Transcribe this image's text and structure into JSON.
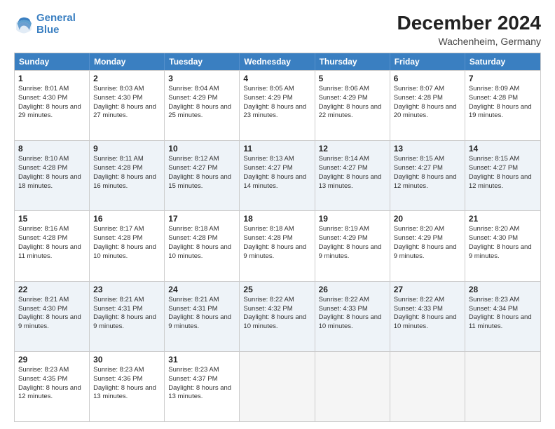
{
  "logo": {
    "line1": "General",
    "line2": "Blue"
  },
  "title": "December 2024",
  "location": "Wachenheim, Germany",
  "days_header": [
    "Sunday",
    "Monday",
    "Tuesday",
    "Wednesday",
    "Thursday",
    "Friday",
    "Saturday"
  ],
  "weeks": [
    [
      {
        "day": "1",
        "rise": "Sunrise: 8:01 AM",
        "set": "Sunset: 4:30 PM",
        "day_text": "Daylight: 8 hours and 29 minutes."
      },
      {
        "day": "2",
        "rise": "Sunrise: 8:03 AM",
        "set": "Sunset: 4:30 PM",
        "day_text": "Daylight: 8 hours and 27 minutes."
      },
      {
        "day": "3",
        "rise": "Sunrise: 8:04 AM",
        "set": "Sunset: 4:29 PM",
        "day_text": "Daylight: 8 hours and 25 minutes."
      },
      {
        "day": "4",
        "rise": "Sunrise: 8:05 AM",
        "set": "Sunset: 4:29 PM",
        "day_text": "Daylight: 8 hours and 23 minutes."
      },
      {
        "day": "5",
        "rise": "Sunrise: 8:06 AM",
        "set": "Sunset: 4:29 PM",
        "day_text": "Daylight: 8 hours and 22 minutes."
      },
      {
        "day": "6",
        "rise": "Sunrise: 8:07 AM",
        "set": "Sunset: 4:28 PM",
        "day_text": "Daylight: 8 hours and 20 minutes."
      },
      {
        "day": "7",
        "rise": "Sunrise: 8:09 AM",
        "set": "Sunset: 4:28 PM",
        "day_text": "Daylight: 8 hours and 19 minutes."
      }
    ],
    [
      {
        "day": "8",
        "rise": "Sunrise: 8:10 AM",
        "set": "Sunset: 4:28 PM",
        "day_text": "Daylight: 8 hours and 18 minutes."
      },
      {
        "day": "9",
        "rise": "Sunrise: 8:11 AM",
        "set": "Sunset: 4:28 PM",
        "day_text": "Daylight: 8 hours and 16 minutes."
      },
      {
        "day": "10",
        "rise": "Sunrise: 8:12 AM",
        "set": "Sunset: 4:27 PM",
        "day_text": "Daylight: 8 hours and 15 minutes."
      },
      {
        "day": "11",
        "rise": "Sunrise: 8:13 AM",
        "set": "Sunset: 4:27 PM",
        "day_text": "Daylight: 8 hours and 14 minutes."
      },
      {
        "day": "12",
        "rise": "Sunrise: 8:14 AM",
        "set": "Sunset: 4:27 PM",
        "day_text": "Daylight: 8 hours and 13 minutes."
      },
      {
        "day": "13",
        "rise": "Sunrise: 8:15 AM",
        "set": "Sunset: 4:27 PM",
        "day_text": "Daylight: 8 hours and 12 minutes."
      },
      {
        "day": "14",
        "rise": "Sunrise: 8:15 AM",
        "set": "Sunset: 4:27 PM",
        "day_text": "Daylight: 8 hours and 12 minutes."
      }
    ],
    [
      {
        "day": "15",
        "rise": "Sunrise: 8:16 AM",
        "set": "Sunset: 4:28 PM",
        "day_text": "Daylight: 8 hours and 11 minutes."
      },
      {
        "day": "16",
        "rise": "Sunrise: 8:17 AM",
        "set": "Sunset: 4:28 PM",
        "day_text": "Daylight: 8 hours and 10 minutes."
      },
      {
        "day": "17",
        "rise": "Sunrise: 8:18 AM",
        "set": "Sunset: 4:28 PM",
        "day_text": "Daylight: 8 hours and 10 minutes."
      },
      {
        "day": "18",
        "rise": "Sunrise: 8:18 AM",
        "set": "Sunset: 4:28 PM",
        "day_text": "Daylight: 8 hours and 9 minutes."
      },
      {
        "day": "19",
        "rise": "Sunrise: 8:19 AM",
        "set": "Sunset: 4:29 PM",
        "day_text": "Daylight: 8 hours and 9 minutes."
      },
      {
        "day": "20",
        "rise": "Sunrise: 8:20 AM",
        "set": "Sunset: 4:29 PM",
        "day_text": "Daylight: 8 hours and 9 minutes."
      },
      {
        "day": "21",
        "rise": "Sunrise: 8:20 AM",
        "set": "Sunset: 4:30 PM",
        "day_text": "Daylight: 8 hours and 9 minutes."
      }
    ],
    [
      {
        "day": "22",
        "rise": "Sunrise: 8:21 AM",
        "set": "Sunset: 4:30 PM",
        "day_text": "Daylight: 8 hours and 9 minutes."
      },
      {
        "day": "23",
        "rise": "Sunrise: 8:21 AM",
        "set": "Sunset: 4:31 PM",
        "day_text": "Daylight: 8 hours and 9 minutes."
      },
      {
        "day": "24",
        "rise": "Sunrise: 8:21 AM",
        "set": "Sunset: 4:31 PM",
        "day_text": "Daylight: 8 hours and 9 minutes."
      },
      {
        "day": "25",
        "rise": "Sunrise: 8:22 AM",
        "set": "Sunset: 4:32 PM",
        "day_text": "Daylight: 8 hours and 10 minutes."
      },
      {
        "day": "26",
        "rise": "Sunrise: 8:22 AM",
        "set": "Sunset: 4:33 PM",
        "day_text": "Daylight: 8 hours and 10 minutes."
      },
      {
        "day": "27",
        "rise": "Sunrise: 8:22 AM",
        "set": "Sunset: 4:33 PM",
        "day_text": "Daylight: 8 hours and 10 minutes."
      },
      {
        "day": "28",
        "rise": "Sunrise: 8:23 AM",
        "set": "Sunset: 4:34 PM",
        "day_text": "Daylight: 8 hours and 11 minutes."
      }
    ],
    [
      {
        "day": "29",
        "rise": "Sunrise: 8:23 AM",
        "set": "Sunset: 4:35 PM",
        "day_text": "Daylight: 8 hours and 12 minutes."
      },
      {
        "day": "30",
        "rise": "Sunrise: 8:23 AM",
        "set": "Sunset: 4:36 PM",
        "day_text": "Daylight: 8 hours and 13 minutes."
      },
      {
        "day": "31",
        "rise": "Sunrise: 8:23 AM",
        "set": "Sunset: 4:37 PM",
        "day_text": "Daylight: 8 hours and 13 minutes."
      },
      null,
      null,
      null,
      null
    ]
  ]
}
